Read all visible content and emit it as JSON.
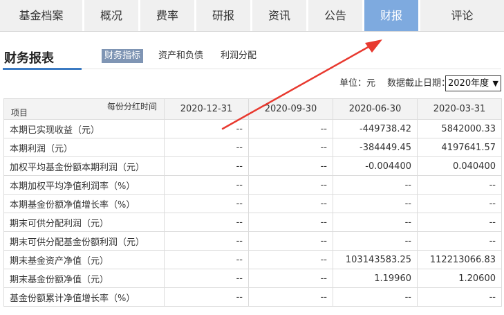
{
  "tabs": [
    {
      "label": "基金档案",
      "active": false
    },
    {
      "label": "概况",
      "active": false
    },
    {
      "label": "费率",
      "active": false
    },
    {
      "label": "研报",
      "active": false
    },
    {
      "label": "资讯",
      "active": false
    },
    {
      "label": "公告",
      "active": false
    },
    {
      "label": "财报",
      "active": true
    },
    {
      "label": "评论",
      "active": false
    }
  ],
  "section": {
    "title": "财务报表",
    "subtabs": [
      {
        "label": "财务指标",
        "active": true
      },
      {
        "label": "资产和负债",
        "active": false
      },
      {
        "label": "利润分配",
        "active": false
      }
    ]
  },
  "toolbar": {
    "unit_text": "单位：元",
    "date_label": "数据截止日期：",
    "date_selected": "2020年度"
  },
  "table": {
    "corner_top": "每份分红时间",
    "corner_bottom": "项目",
    "columns": [
      "2020-12-31",
      "2020-09-30",
      "2020-06-30",
      "2020-03-31"
    ],
    "rows": [
      {
        "label": "本期已实现收益（元）",
        "values": [
          "--",
          "--",
          "-449738.42",
          "5842000.33"
        ]
      },
      {
        "label": "本期利润（元）",
        "values": [
          "--",
          "--",
          "-384449.45",
          "4197641.57"
        ]
      },
      {
        "label": "加权平均基金份额本期利润（元）",
        "values": [
          "--",
          "--",
          "-0.004400",
          "0.040400"
        ]
      },
      {
        "label": "本期加权平均净值利润率（%）",
        "values": [
          "--",
          "--",
          "--",
          "--"
        ]
      },
      {
        "label": "本期基金份额净值增长率（%）",
        "values": [
          "--",
          "--",
          "--",
          "--"
        ]
      },
      {
        "label": "期末可供分配利润（元）",
        "values": [
          "--",
          "--",
          "--",
          "--"
        ]
      },
      {
        "label": "期末可供分配基金份额利润（元）",
        "values": [
          "--",
          "--",
          "--",
          "--"
        ]
      },
      {
        "label": "期末基金资产净值（元）",
        "values": [
          "--",
          "--",
          "103143583.25",
          "112213066.83"
        ]
      },
      {
        "label": "期末基金份额净值（元）",
        "values": [
          "--",
          "--",
          "1.19960",
          "1.20600"
        ]
      },
      {
        "label": "基金份额累计净值增长率（%）",
        "values": [
          "--",
          "--",
          "--",
          "--"
        ]
      }
    ]
  },
  "colors": {
    "tab_active_bg": "#7eaadf",
    "subtab_active_bg": "#7f95b4",
    "accent_underline": "#3b7ac2",
    "annotation_arrow": "#e8392f"
  }
}
